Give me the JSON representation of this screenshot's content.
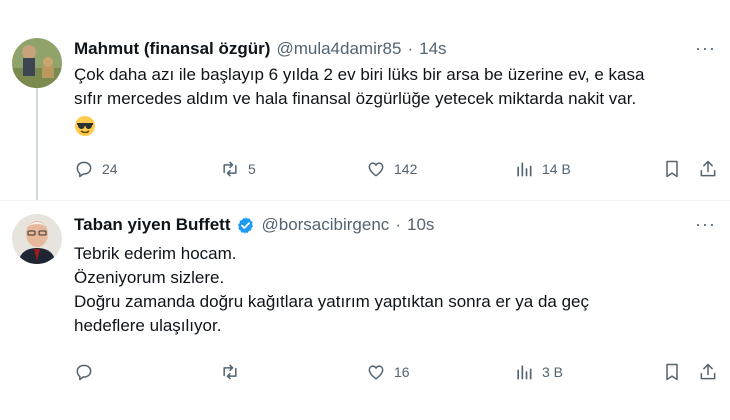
{
  "tweets": [
    {
      "name": "Mahmut (finansal özgür)",
      "handle": "@mula4damir85",
      "separator": "·",
      "time": "14s",
      "verified": false,
      "lines": [
        "Çok daha azı ile başlayıp 6 yılda 2 ev biri lüks bir arsa be üzerine ev, e kasa",
        "sıfır mercedes aldım ve hala finansal özgürlüğe yetecek miktarda nakit var."
      ],
      "emoji": "smiling-face-with-sunglasses",
      "reply_count": "24",
      "retweet_count": "5",
      "like_count": "142",
      "view_count": "14 B"
    },
    {
      "name": "Taban yiyen Buffett",
      "handle": "@borsacibirgenc",
      "separator": "·",
      "time": "10s",
      "verified": true,
      "lines": [
        "Tebrik ederim hocam.",
        "Özeniyorum sizlere.",
        "Doğru zamanda doğru kağıtlara yatırım yaptıktan sonra er ya da geç",
        "hedeflere ulaşılıyor."
      ],
      "reply_count": "",
      "retweet_count": "",
      "like_count": "16",
      "view_count": "3 B"
    }
  ],
  "colors": {
    "text": "#0f1419",
    "secondary": "#536471",
    "verified_blue": "#1d9bf0",
    "thread_line": "#cfd9de"
  },
  "more_glyph": "···"
}
